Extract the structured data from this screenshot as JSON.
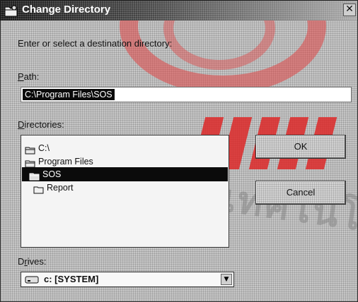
{
  "window": {
    "title": "Change Directory",
    "close_glyph": "✕",
    "icon": "folder-app-icon"
  },
  "prompt": "Enter or select a destination directory:",
  "path": {
    "label_accel": "P",
    "label_rest": "ath:",
    "value": "C:\\Program Files\\SOS"
  },
  "directories": {
    "label_accel": "D",
    "label_rest": "irectories:",
    "items": [
      {
        "label": "C:\\",
        "icon": "open-folder-icon",
        "depth": 0,
        "selected": false
      },
      {
        "label": "Program Files",
        "icon": "open-folder-icon",
        "depth": 1,
        "selected": false
      },
      {
        "label": "SOS",
        "icon": "open-folder-icon",
        "depth": 2,
        "selected": true
      },
      {
        "label": "Report",
        "icon": "folder-icon",
        "depth": 3,
        "selected": false
      }
    ]
  },
  "buttons": {
    "ok": "OK",
    "cancel": "Cancel"
  },
  "drives": {
    "label_accel": "r",
    "label_pre": "D",
    "label_rest": "ives:",
    "selected": "c: [SYSTEM]",
    "icon": "hard-drive-icon"
  },
  "watermark": {
    "text": "วิทยาลัยเทคโนโลยี",
    "color": "#e04646"
  }
}
